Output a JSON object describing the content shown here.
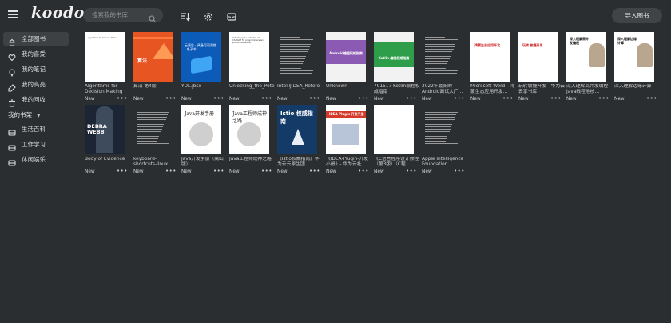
{
  "app": {
    "logo": "koodo"
  },
  "search": {
    "placeholder": "搜索我的书库"
  },
  "header": {
    "import_label": "导入图书"
  },
  "sidebar": {
    "items": [
      {
        "label": "全部图书",
        "icon": "home-icon",
        "active": true
      },
      {
        "label": "我的喜爱",
        "icon": "heart-icon"
      },
      {
        "label": "我的笔记",
        "icon": "lightbulb-icon"
      },
      {
        "label": "我的高亮",
        "icon": "highlighter-icon"
      },
      {
        "label": "我的回收",
        "icon": "trash-icon"
      }
    ],
    "shelf_heading": "我的书架",
    "shelves": [
      {
        "label": "生活百科",
        "icon": "shelf-icon"
      },
      {
        "label": "工作学习",
        "icon": "shelf-icon"
      },
      {
        "label": "休闲娱乐",
        "icon": "shelf-icon"
      }
    ]
  },
  "books": [
    {
      "title": "Algorithms for Decision Making",
      "status": "New",
      "cover_text": "Algorithms for Decision Making",
      "style": "white"
    },
    {
      "title": "算法 第4版",
      "status": "New",
      "cover_text": "算法",
      "style": "orange"
    },
    {
      "title": "YDL.jbsx",
      "status": "New",
      "cover_text": "云原生 · 具备可观测性 · 电子书",
      "style": "blue"
    },
    {
      "title": "Unlocking_the_Pote",
      "status": "New",
      "cover_text": "Unlocking the potential of ChatGPT for programmers and productive teams",
      "style": "text"
    },
    {
      "title": "IntelliJIDEA_Refere",
      "status": "New",
      "cover_text": "",
      "style": "lines"
    },
    {
      "title": "Unknown",
      "status": "New",
      "cover_text": "Android编程权威指南",
      "style": "android"
    },
    {
      "title": "791517 Kotlin编程权威指南",
      "status": "New",
      "cover_text": "Kotlin 编程权威指南",
      "style": "kotlin"
    },
    {
      "title": "2022年最新的Android面试大厂…",
      "status": "New",
      "cover_text": "",
      "style": "lines"
    },
    {
      "title": "Microsoft Word - 鸿蒙生态应用开发…",
      "status": "New",
      "cover_text": "鸿蒙生态应用开发",
      "style": "red"
    },
    {
      "title": "玩转敏捷开发 - 华为云 云享书库",
      "status": "New",
      "cover_text": "玩转 敏捷开发",
      "style": "red"
    },
    {
      "title": "深入理解高并发编程-Java线程池核…",
      "status": "New",
      "cover_text": "深入理解高并发编程",
      "style": "cn"
    },
    {
      "title": "深入理解边缘计算",
      "status": "New",
      "cover_text": "深入理解边缘计算",
      "style": "cn"
    },
    {
      "title": "Body of Evidence",
      "status": "New",
      "cover_text": "DEBRA WEBB",
      "style": "novel"
    },
    {
      "title": "keyboard-shortcuts-linux",
      "status": "New",
      "cover_text": "",
      "style": "lines"
    },
    {
      "title": "Java开发手册（嵩山版）",
      "status": "New",
      "cover_text": "Java开发手册",
      "style": "ink"
    },
    {
      "title": "Java工程师成神之路",
      "status": "New",
      "cover_text": "Java工程师成神之路",
      "style": "ink"
    },
    {
      "title": "《Istio权威指南》华为云云原生团…",
      "status": "New",
      "cover_text": "Istio 权威指南",
      "style": "istio"
    },
    {
      "title": "《IDEA-Plugin-开发小册》- 华为云社…",
      "status": "New",
      "cover_text": "IDEA Plugin 开发手册",
      "style": "plugin"
    },
    {
      "title": "《C语言程序设计教程（第3版）（C程…",
      "status": "New",
      "cover_text": "",
      "style": "blank"
    },
    {
      "title": "Apple Intelligence Foundation…",
      "status": "New",
      "cover_text": "",
      "style": "lines"
    }
  ]
}
